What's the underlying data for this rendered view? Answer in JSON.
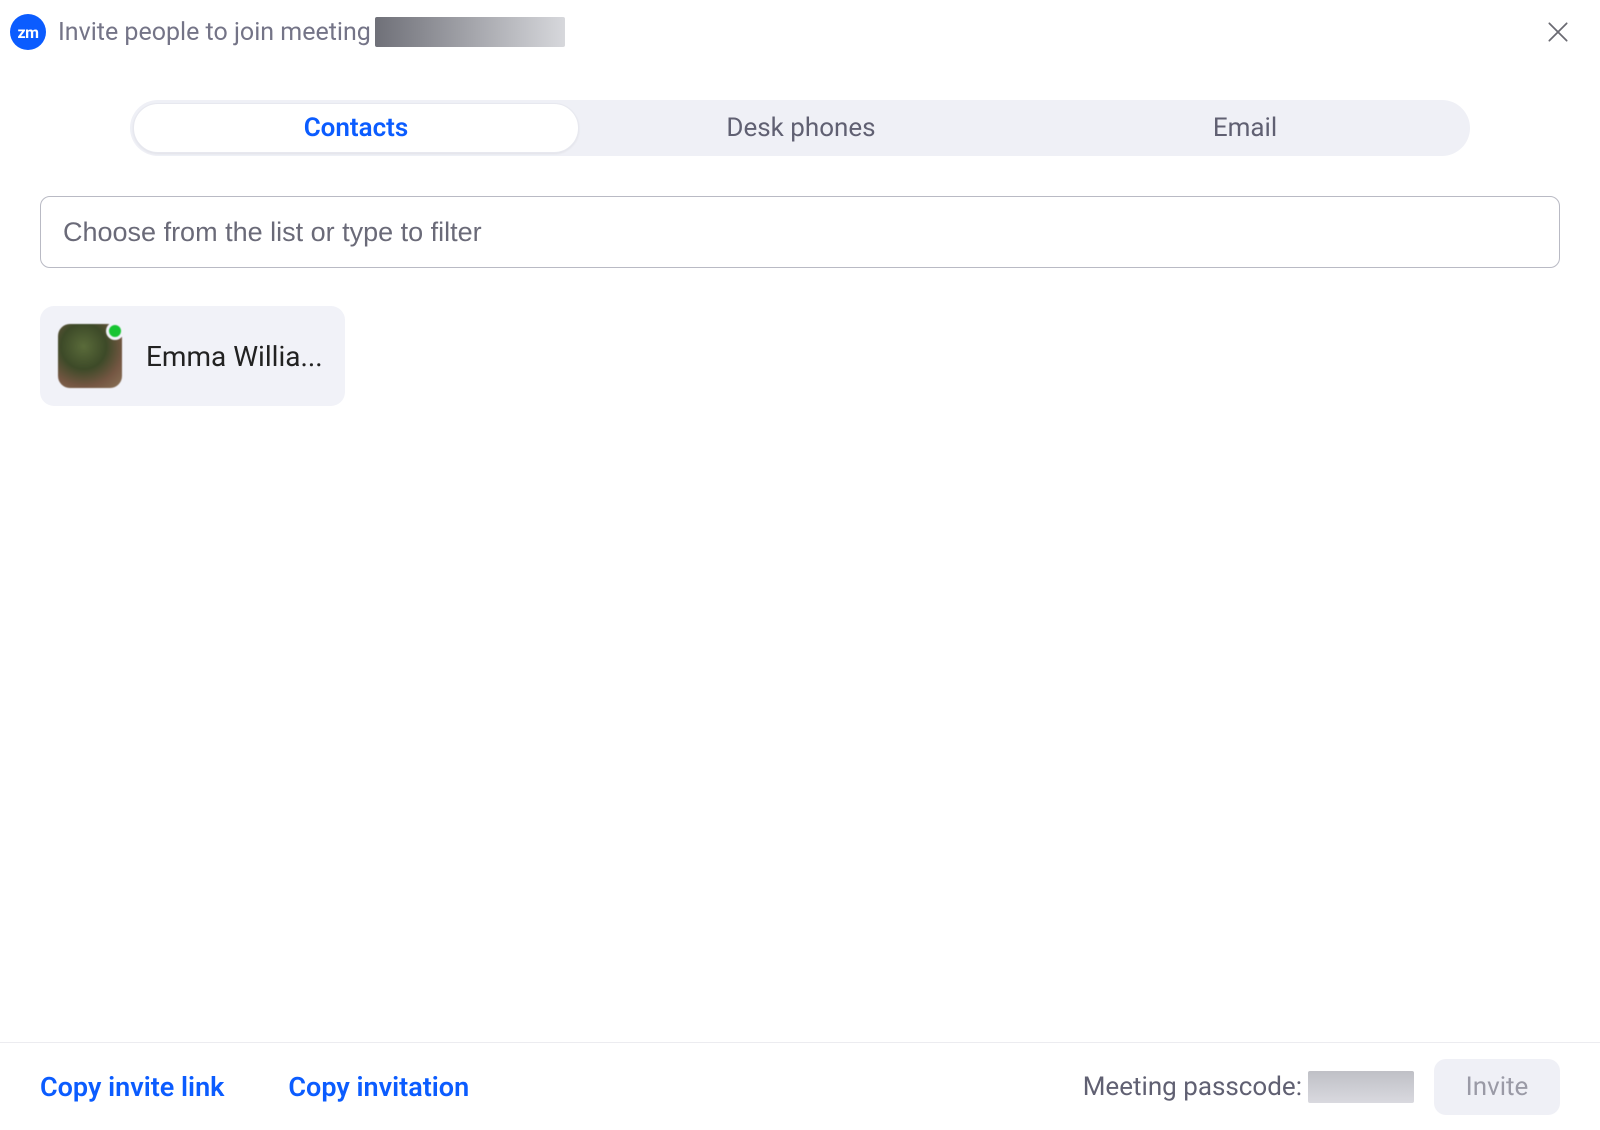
{
  "header": {
    "logo_text": "zm",
    "title": "Invite people to join meeting"
  },
  "tabs": [
    {
      "label": "Contacts",
      "active": true
    },
    {
      "label": "Desk phones",
      "active": false
    },
    {
      "label": "Email",
      "active": false
    }
  ],
  "search": {
    "placeholder": "Choose from the list or type to filter",
    "value": ""
  },
  "contacts": [
    {
      "name": "Emma Willia...",
      "presence": "online"
    }
  ],
  "footer": {
    "copy_link_label": "Copy invite link",
    "copy_invitation_label": "Copy invitation",
    "passcode_label": "Meeting passcode:",
    "invite_button_label": "Invite"
  },
  "colors": {
    "accent": "#0b5cff",
    "pill_bg": "#eff0f6",
    "presence_online": "#16c431"
  }
}
